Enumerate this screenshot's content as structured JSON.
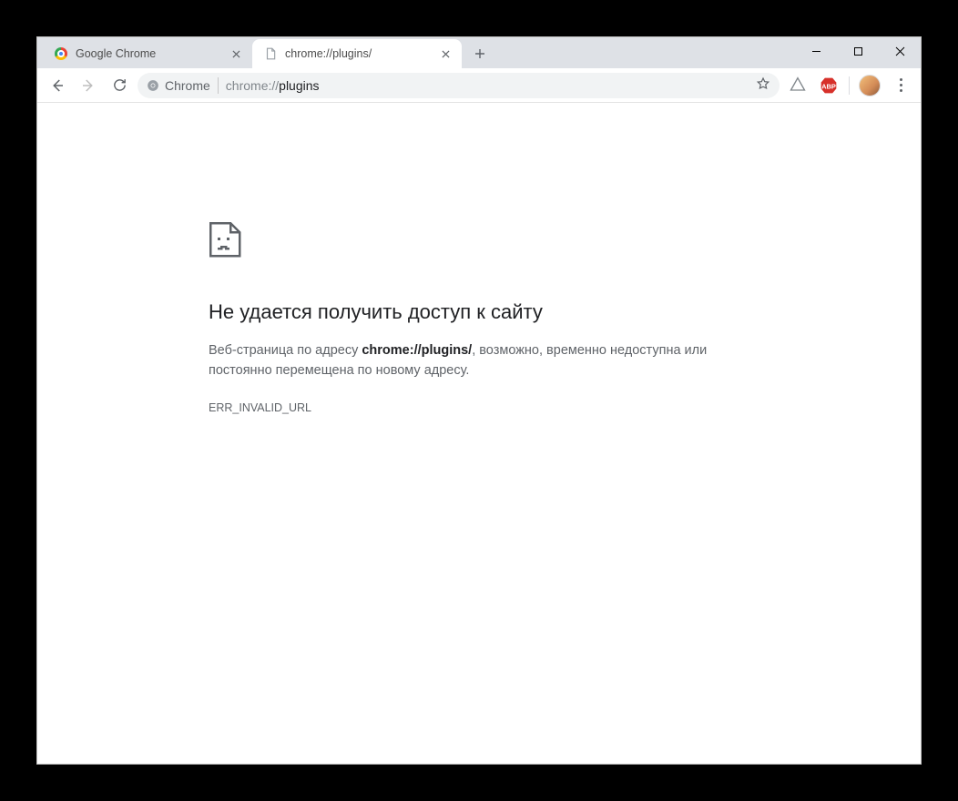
{
  "tabs": [
    {
      "title": "Google Chrome",
      "active": false
    },
    {
      "title": "chrome://plugins/",
      "active": true
    }
  ],
  "omnibox": {
    "chip_label": "Chrome",
    "url_prefix": "chrome://",
    "url_bold": "plugins"
  },
  "error": {
    "title": "Не удается получить доступ к сайту",
    "msg_before": "Веб-страница по адресу ",
    "msg_bold": "chrome://plugins/",
    "msg_after": ", возможно, временно недоступна или постоянно перемещена по новому адресу.",
    "code": "ERR_INVALID_URL"
  }
}
